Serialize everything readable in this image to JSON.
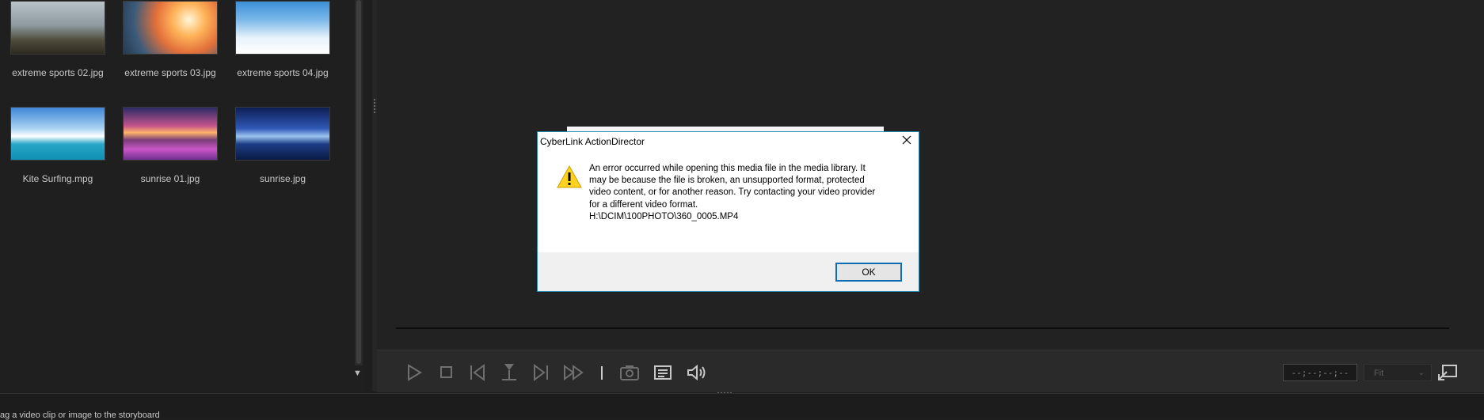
{
  "library": {
    "items": [
      {
        "name": "extreme sports 02.jpg"
      },
      {
        "name": "extreme sports 03.jpg"
      },
      {
        "name": "extreme sports 04.jpg"
      },
      {
        "name": "Kite Surfing.mpg"
      },
      {
        "name": "sunrise 01.jpg"
      },
      {
        "name": "sunrise.jpg"
      }
    ]
  },
  "player": {
    "timecode": "--;--;--;--",
    "zoom": "Fit"
  },
  "status": {
    "text": "ag a video clip or image to the storyboard"
  },
  "dialog": {
    "title": "CyberLink ActionDirector",
    "message_lines": [
      "An error occurred while opening this media file in the media library. It",
      "may be because the file is broken, an unsupported format, protected",
      "video content, or for another reason. Try contacting your video provider",
      "for a different video format.",
      "H:\\DCIM\\100PHOTO\\360_0005.MP4"
    ],
    "ok_label": "OK"
  },
  "icons": {
    "play": "play-icon",
    "stop": "stop-icon",
    "prev": "previous-frame-icon",
    "split": "split-icon",
    "next": "next-frame-icon",
    "fast_forward": "fast-forward-icon",
    "snapshot": "camera-icon",
    "subtitles": "list-icon",
    "volume": "volume-icon",
    "fullscreen": "external-display-icon",
    "warning": "warning-icon",
    "close": "close-icon"
  },
  "colors": {
    "dialog_border": "#2b8bb3",
    "ok_border": "#0f6db5",
    "warning_fill": "#ffd21f"
  }
}
